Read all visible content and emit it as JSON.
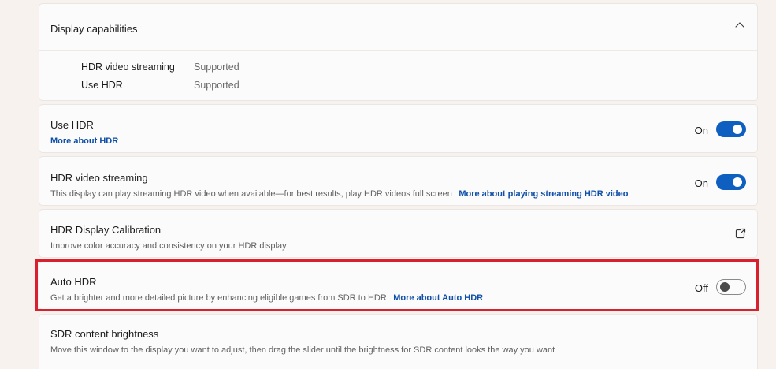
{
  "capabilities": {
    "title": "Display capabilities",
    "items": [
      {
        "label": "HDR video streaming",
        "value": "Supported"
      },
      {
        "label": "Use HDR",
        "value": "Supported"
      }
    ]
  },
  "use_hdr": {
    "title": "Use HDR",
    "link": "More about HDR",
    "state": "On"
  },
  "hdr_streaming": {
    "title": "HDR video streaming",
    "description": "This display can play streaming HDR video when available—for best results, play HDR videos full screen",
    "link": "More about playing streaming HDR video",
    "state": "On"
  },
  "calibration": {
    "title": "HDR Display Calibration",
    "description": "Improve color accuracy and consistency on your HDR display"
  },
  "auto_hdr": {
    "title": "Auto HDR",
    "description": "Get a brighter and more detailed picture by enhancing eligible games from SDR to HDR",
    "link": "More about Auto HDR",
    "state": "Off"
  },
  "sdr_brightness": {
    "title": "SDR content brightness",
    "description": "Move this window to the display you want to adjust, then drag the slider until the brightness for SDR content looks the way you want"
  },
  "colors": {
    "accent": "#0f5fc0",
    "link": "#0f4fa8",
    "highlight": "#d8212f"
  }
}
